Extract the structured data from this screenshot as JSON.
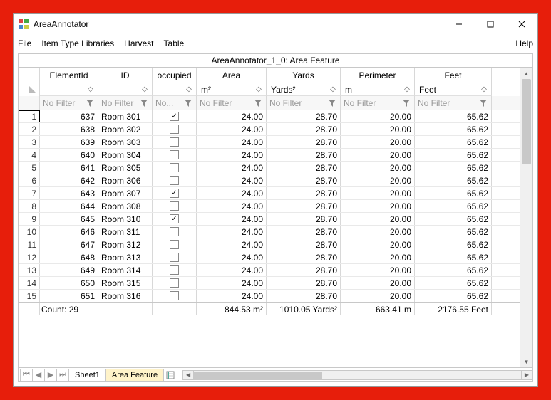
{
  "title": "AreaAnnotator",
  "menu": {
    "file": "File",
    "itl": "Item Type Libraries",
    "harvest": "Harvest",
    "table": "Table",
    "help": "Help"
  },
  "doc_title": "AreaAnnotator_1_0: Area Feature",
  "cols": {
    "elem": {
      "label": "ElementId",
      "unit": ""
    },
    "id": {
      "label": "ID",
      "unit": ""
    },
    "occ": {
      "label": "occupied",
      "unit": ""
    },
    "area": {
      "label": "Area",
      "unit": "m²"
    },
    "yards": {
      "label": "Yards",
      "unit": "Yards²"
    },
    "perim": {
      "label": "Perimeter",
      "unit": "m"
    },
    "feet": {
      "label": "Feet",
      "unit": "Feet"
    }
  },
  "filter_label": "No Filter",
  "filter_label_short": "No...",
  "rows": [
    {
      "n": "1",
      "elem": "637",
      "id": "Room 301",
      "occ": true,
      "area": "24.00",
      "yards": "28.70",
      "perim": "20.00",
      "feet": "65.62"
    },
    {
      "n": "2",
      "elem": "638",
      "id": "Room 302",
      "occ": false,
      "area": "24.00",
      "yards": "28.70",
      "perim": "20.00",
      "feet": "65.62"
    },
    {
      "n": "3",
      "elem": "639",
      "id": "Room 303",
      "occ": false,
      "area": "24.00",
      "yards": "28.70",
      "perim": "20.00",
      "feet": "65.62"
    },
    {
      "n": "4",
      "elem": "640",
      "id": "Room 304",
      "occ": false,
      "area": "24.00",
      "yards": "28.70",
      "perim": "20.00",
      "feet": "65.62"
    },
    {
      "n": "5",
      "elem": "641",
      "id": "Room 305",
      "occ": false,
      "area": "24.00",
      "yards": "28.70",
      "perim": "20.00",
      "feet": "65.62"
    },
    {
      "n": "6",
      "elem": "642",
      "id": "Room 306",
      "occ": false,
      "area": "24.00",
      "yards": "28.70",
      "perim": "20.00",
      "feet": "65.62"
    },
    {
      "n": "7",
      "elem": "643",
      "id": "Room 307",
      "occ": true,
      "area": "24.00",
      "yards": "28.70",
      "perim": "20.00",
      "feet": "65.62"
    },
    {
      "n": "8",
      "elem": "644",
      "id": "Room 308",
      "occ": false,
      "area": "24.00",
      "yards": "28.70",
      "perim": "20.00",
      "feet": "65.62"
    },
    {
      "n": "9",
      "elem": "645",
      "id": "Room 310",
      "occ": true,
      "area": "24.00",
      "yards": "28.70",
      "perim": "20.00",
      "feet": "65.62"
    },
    {
      "n": "10",
      "elem": "646",
      "id": "Room 311",
      "occ": false,
      "area": "24.00",
      "yards": "28.70",
      "perim": "20.00",
      "feet": "65.62"
    },
    {
      "n": "11",
      "elem": "647",
      "id": "Room 312",
      "occ": false,
      "area": "24.00",
      "yards": "28.70",
      "perim": "20.00",
      "feet": "65.62"
    },
    {
      "n": "12",
      "elem": "648",
      "id": "Room 313",
      "occ": false,
      "area": "24.00",
      "yards": "28.70",
      "perim": "20.00",
      "feet": "65.62"
    },
    {
      "n": "13",
      "elem": "649",
      "id": "Room 314",
      "occ": false,
      "area": "24.00",
      "yards": "28.70",
      "perim": "20.00",
      "feet": "65.62"
    },
    {
      "n": "14",
      "elem": "650",
      "id": "Room 315",
      "occ": false,
      "area": "24.00",
      "yards": "28.70",
      "perim": "20.00",
      "feet": "65.62"
    },
    {
      "n": "15",
      "elem": "651",
      "id": "Room 316",
      "occ": false,
      "area": "24.00",
      "yards": "28.70",
      "perim": "20.00",
      "feet": "65.62"
    }
  ],
  "totals": {
    "count_label": "Count: 29",
    "area": "844.53 m²",
    "yards": "1010.05 Yards²",
    "perim": "663.41 m",
    "feet": "2176.55 Feet"
  },
  "tabs": {
    "sheet1": "Sheet1",
    "area_feature": "Area Feature"
  }
}
